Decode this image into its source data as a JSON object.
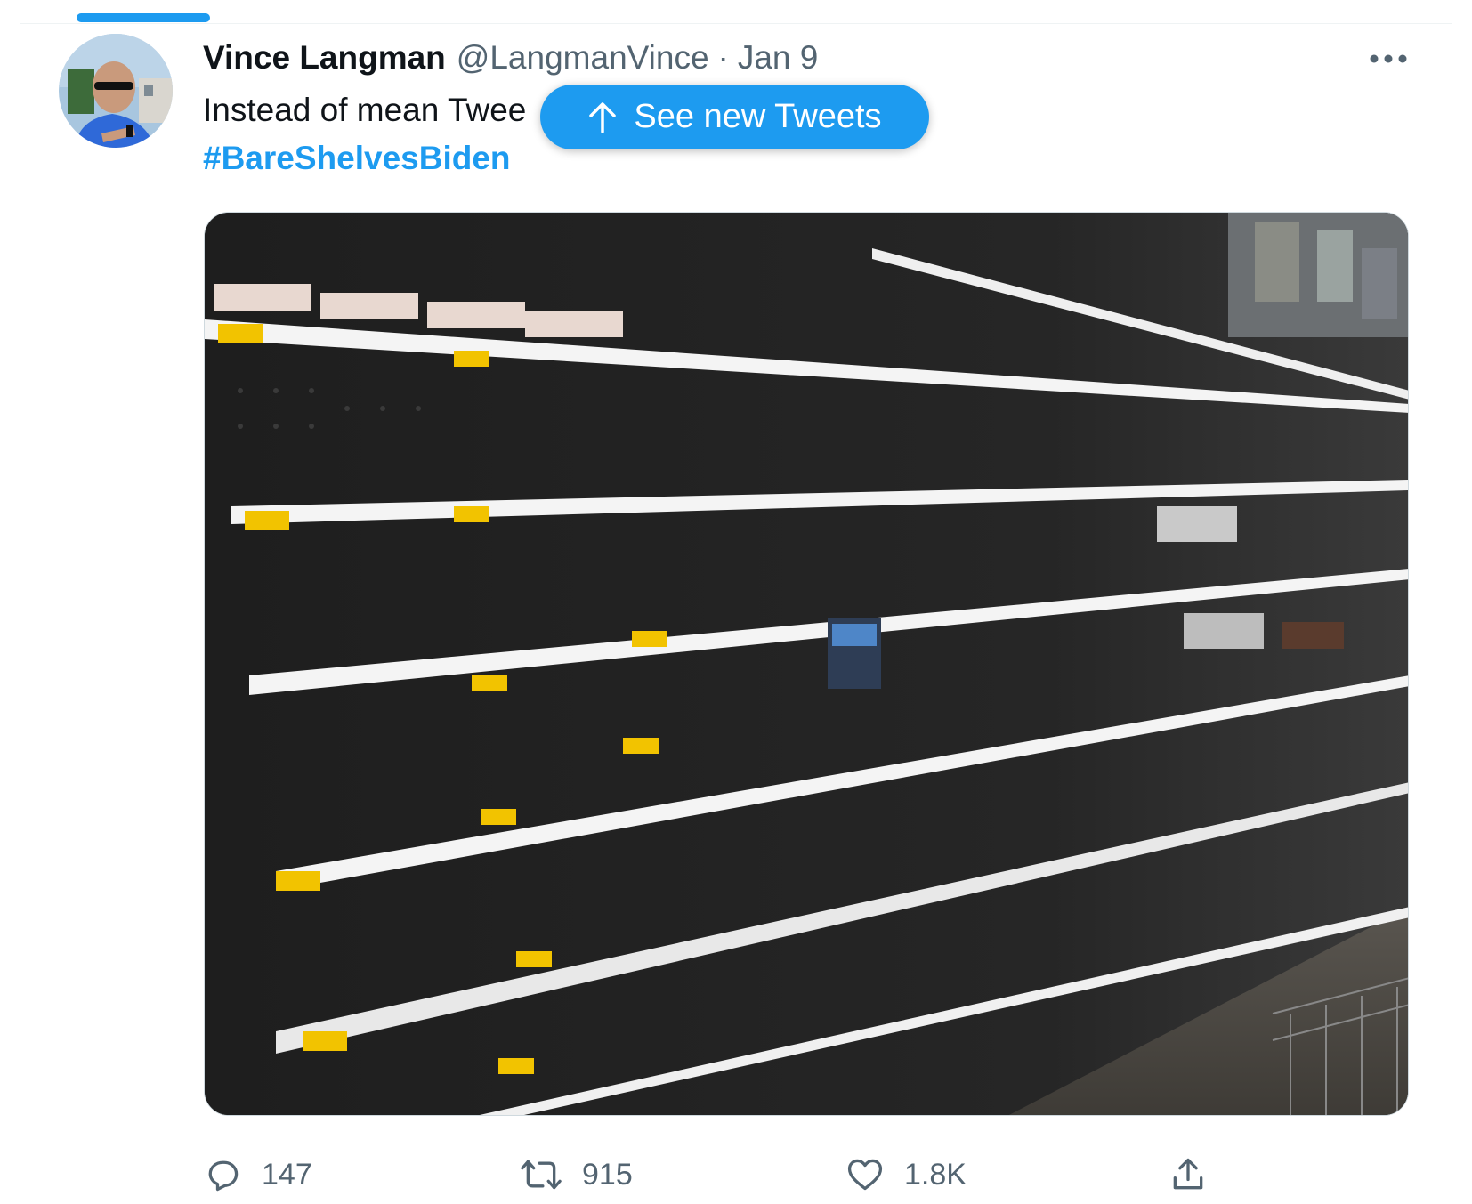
{
  "tweet": {
    "author": {
      "display_name": "Vince Langman",
      "handle": "@LangmanVince",
      "separator": "·",
      "date": "Jan 9"
    },
    "text": "Instead of mean Twee",
    "hashtag": "#BareShelvesBiden",
    "actions": {
      "reply_count": "147",
      "retweet_count": "915",
      "like_count": "1.8K"
    }
  },
  "new_tweets_pill": {
    "label": "See new Tweets"
  },
  "colors": {
    "accent": "#1d9bf0",
    "secondary_text": "#536471",
    "primary_text": "#0f1419"
  },
  "icons": [
    "more-icon",
    "arrow-up-icon",
    "reply-icon",
    "retweet-icon",
    "like-icon",
    "share-icon"
  ]
}
